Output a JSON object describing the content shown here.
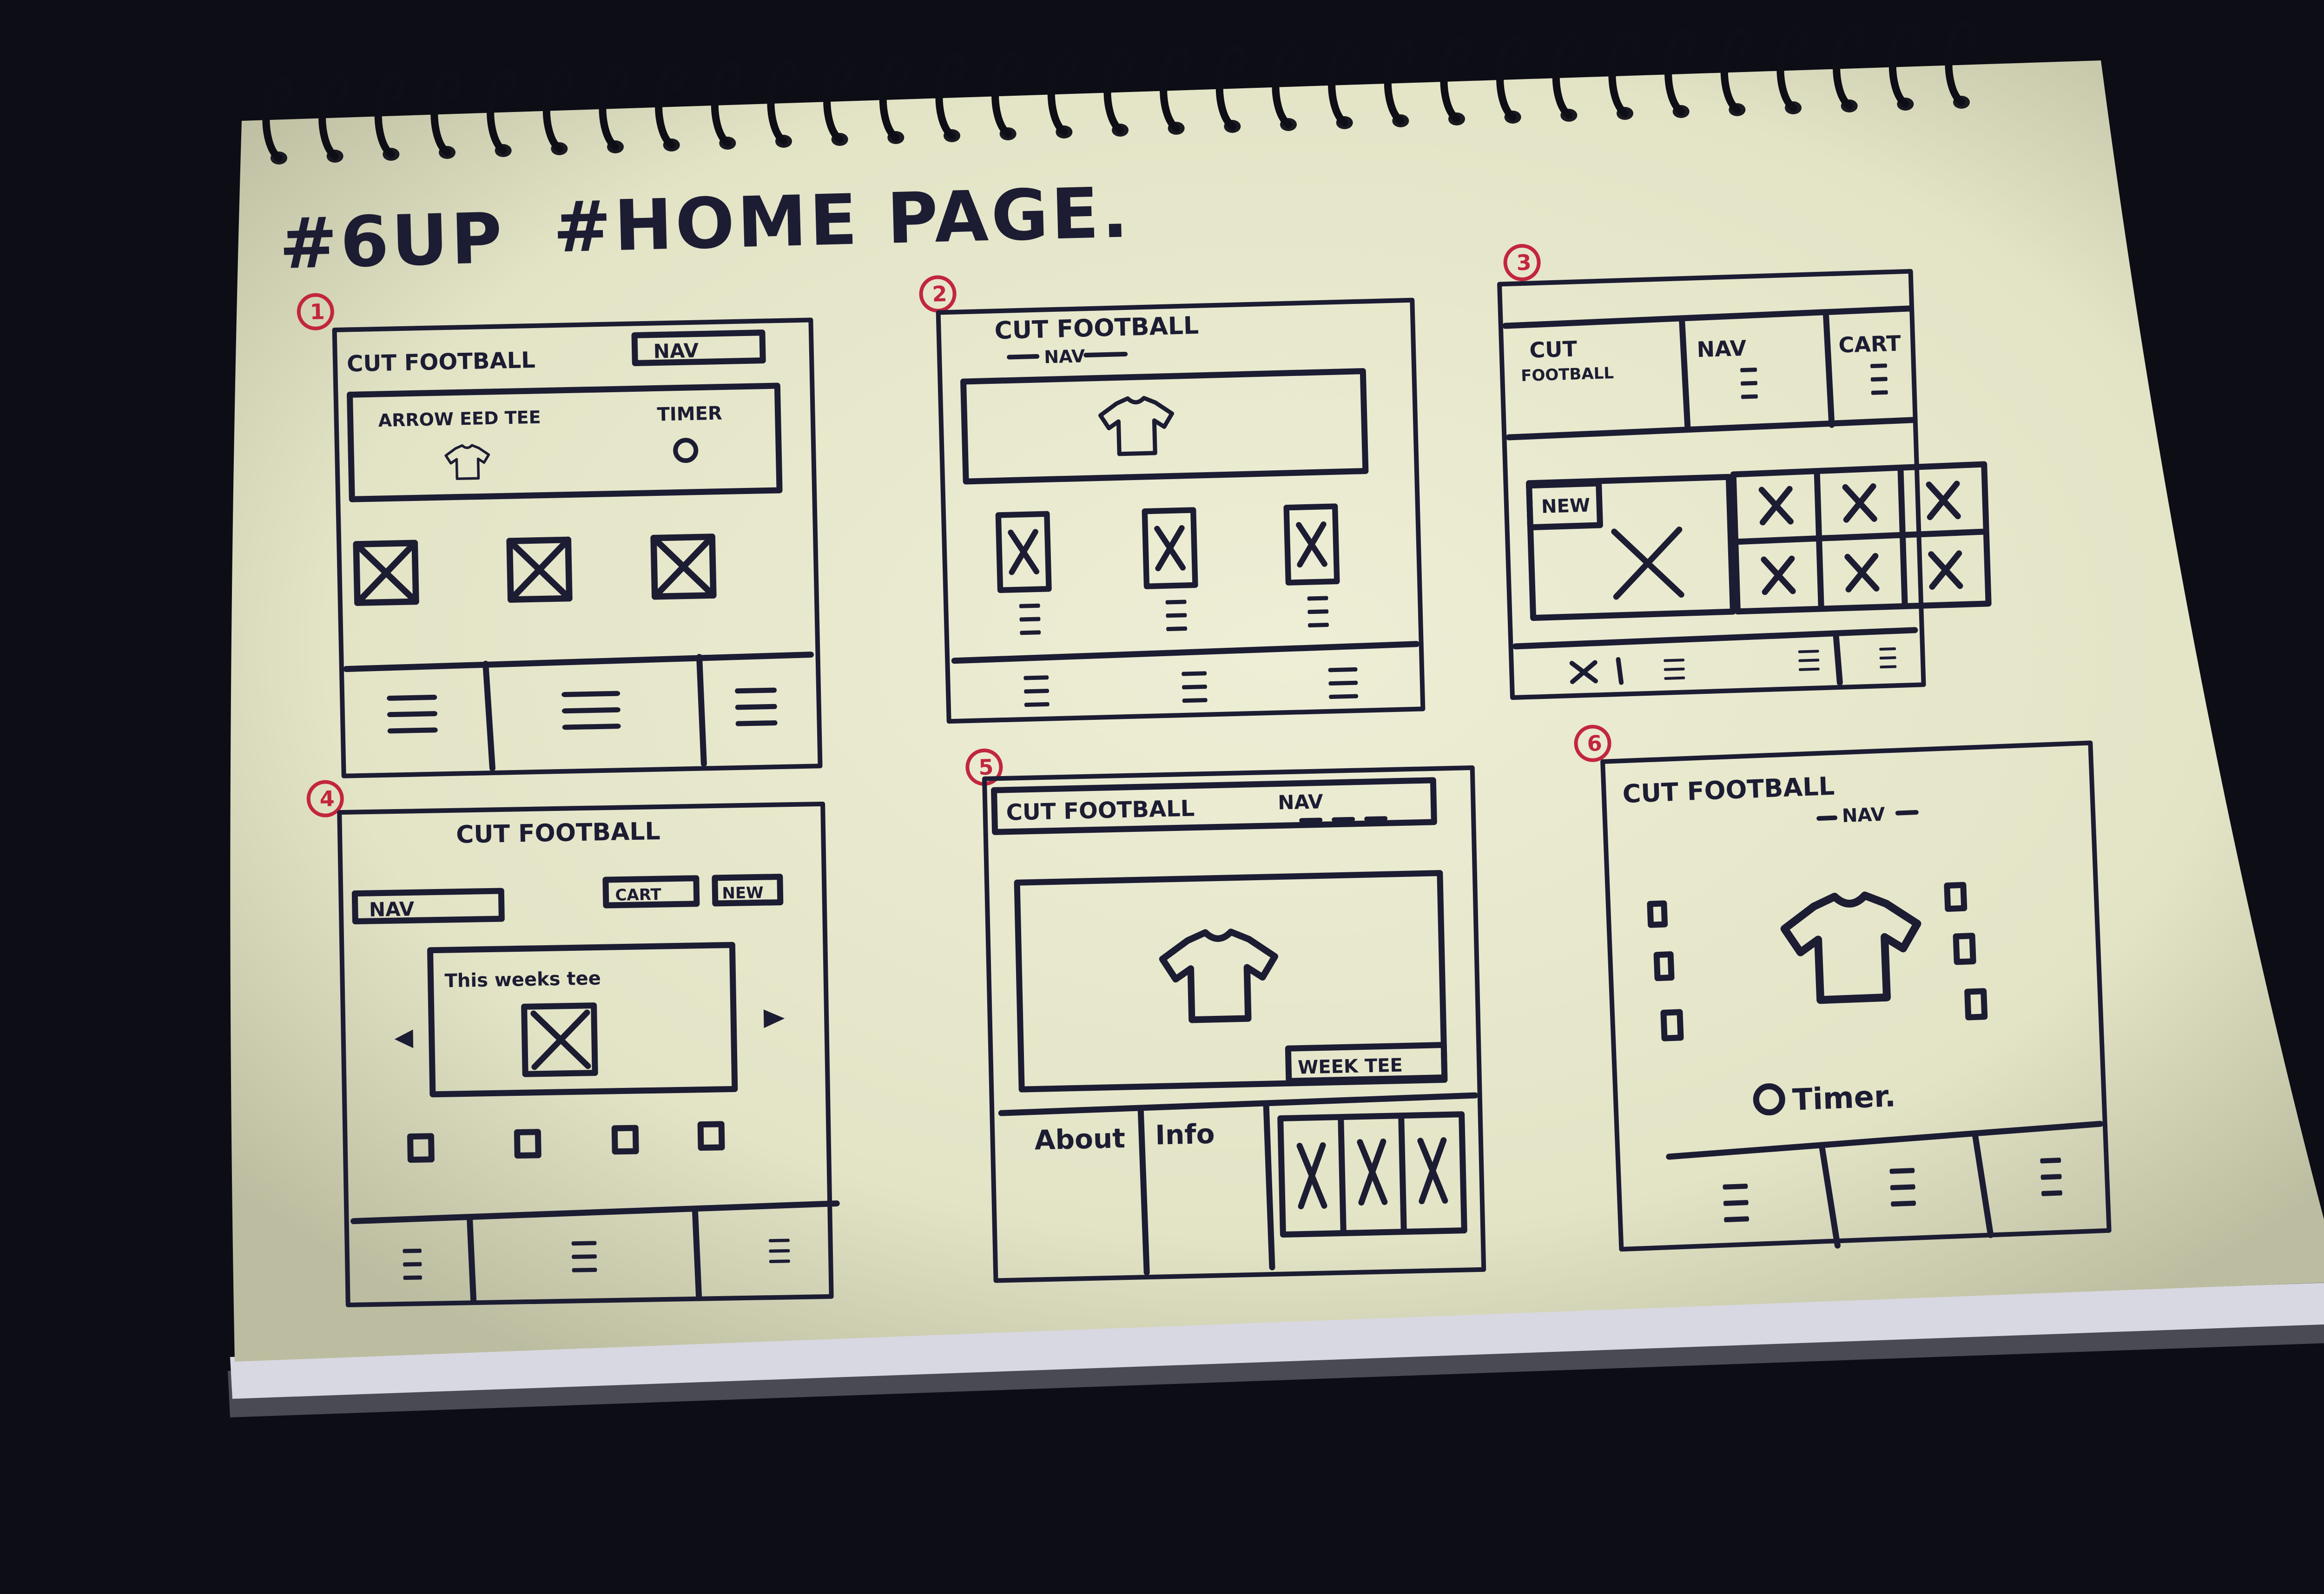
{
  "heading": {
    "tag1": "#6UP",
    "tag2": "#HOME PAGE."
  },
  "sketch_numbers": [
    "1",
    "2",
    "3",
    "4",
    "5",
    "6"
  ],
  "sketch1": {
    "brand": "CUT FOOTBALL",
    "nav": "NAV",
    "promo": "ARROW EED TEE",
    "timer": "TIMER"
  },
  "sketch2": {
    "brand": "CUT FOOTBALL",
    "nav": "NAV"
  },
  "sketch3": {
    "brand_line1": "CUT",
    "brand_line2": "FOOTBALL",
    "nav": "NAV",
    "cart": "CART",
    "new_badge": "NEW"
  },
  "sketch4": {
    "brand": "CUT FOOTBALL",
    "nav": "NAV",
    "cart": "CART",
    "new_btn": "NEW",
    "carousel_title": "This weeks tee"
  },
  "sketch5": {
    "brand": "CUT FOOTBALL",
    "nav": "NAV",
    "week_badge": "WEEK TEE",
    "about": "About",
    "info": "Info"
  },
  "sketch6": {
    "brand": "CUT FOOTBALL",
    "nav": "NAV",
    "timer": "Timer."
  },
  "colors": {
    "background": "#0d0d16",
    "paper": "#e9e9cf",
    "ink": "#1c1d33",
    "number_ink": "#c2263f",
    "spiral": "#0e0e16"
  }
}
